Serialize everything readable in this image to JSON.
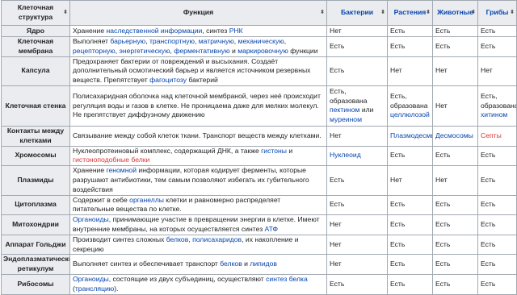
{
  "headers": {
    "structure": "Клеточная структура",
    "function": "Функция",
    "bacteria": "Бактерии",
    "plants": "Растения",
    "animals": "Животные",
    "fungi": "Грибы"
  },
  "rows": [
    {
      "name": "Ядро",
      "function": [
        {
          "t": "Хранение "
        },
        {
          "t": "наследственной информации",
          "l": true
        },
        {
          "t": ", синтез "
        },
        {
          "t": "РНК",
          "l": true
        }
      ],
      "bacteria": [
        {
          "t": "Нет"
        }
      ],
      "plants": [
        {
          "t": "Есть"
        }
      ],
      "animals": [
        {
          "t": "Есть"
        }
      ],
      "fungi": [
        {
          "t": "Есть"
        }
      ]
    },
    {
      "name": "Клеточная мембрана",
      "function": [
        {
          "t": "Выполняет "
        },
        {
          "t": "барьерную",
          "l": true
        },
        {
          "t": ", "
        },
        {
          "t": "транспортную",
          "l": true
        },
        {
          "t": ", "
        },
        {
          "t": "матричную",
          "l": true
        },
        {
          "t": ", "
        },
        {
          "t": "механическую",
          "l": true
        },
        {
          "t": ", "
        },
        {
          "t": "рецепторную",
          "l": true
        },
        {
          "t": ", "
        },
        {
          "t": "энергетическую",
          "l": true
        },
        {
          "t": ", "
        },
        {
          "t": "ферментативную",
          "l": true
        },
        {
          "t": " и "
        },
        {
          "t": "маркировочную",
          "l": true
        },
        {
          "t": " функции"
        }
      ],
      "bacteria": [
        {
          "t": "Есть"
        }
      ],
      "plants": [
        {
          "t": "Есть"
        }
      ],
      "animals": [
        {
          "t": "Есть"
        }
      ],
      "fungi": [
        {
          "t": "Есть"
        }
      ]
    },
    {
      "name": "Капсула",
      "function": [
        {
          "t": "Предохраняет бактерии от повреждений и высыхания. Создаёт дополнительный осмотический барьер и является источником резервных веществ. Препятствует "
        },
        {
          "t": "фагоцитозу",
          "l": true
        },
        {
          "t": " бактерий"
        }
      ],
      "bacteria": [
        {
          "t": "Есть"
        }
      ],
      "plants": [
        {
          "t": "Нет"
        }
      ],
      "animals": [
        {
          "t": "Нет"
        }
      ],
      "fungi": [
        {
          "t": "Нет"
        }
      ]
    },
    {
      "name": "Клеточная стенка",
      "function": [
        {
          "t": "Полисахаридная оболочка над клеточной мембраной, через неё происходит регуляция воды и газов в клетке. Не проницаема даже для мелких молекул. Не препятствует диффузному движению"
        }
      ],
      "bacteria": [
        {
          "t": "Есть, образована "
        },
        {
          "t": "пектином",
          "l": true
        },
        {
          "t": " или "
        },
        {
          "t": "муреином",
          "l": true
        }
      ],
      "plants": [
        {
          "t": "Есть, образована "
        },
        {
          "t": "целлюлозой",
          "l": true
        }
      ],
      "animals": [
        {
          "t": "Нет"
        }
      ],
      "fungi": [
        {
          "t": "Есть, образована "
        },
        {
          "t": "хитином",
          "l": true
        }
      ]
    },
    {
      "name": "Контакты между клетками",
      "function": [
        {
          "t": "Связывание между собой клеток ткани. Транспорт веществ между клетками."
        }
      ],
      "bacteria": [
        {
          "t": "Нет"
        }
      ],
      "plants": [
        {
          "t": "Плазмодесмы",
          "l": true
        }
      ],
      "animals": [
        {
          "t": "Десмосомы",
          "l": true
        }
      ],
      "fungi": [
        {
          "t": "Септы",
          "r": true
        }
      ]
    },
    {
      "name": "Хромосомы",
      "function": [
        {
          "t": "Нуклеопротеиновый комплекс, содержащий ДНК, а также "
        },
        {
          "t": "гистоны",
          "l": true
        },
        {
          "t": " и "
        },
        {
          "t": "гистоноподобные белки",
          "r": true
        }
      ],
      "bacteria": [
        {
          "t": "Нуклеоид",
          "l": true
        }
      ],
      "plants": [
        {
          "t": "Есть"
        }
      ],
      "animals": [
        {
          "t": "Есть"
        }
      ],
      "fungi": [
        {
          "t": "Есть"
        }
      ]
    },
    {
      "name": "Плазмиды",
      "function": [
        {
          "t": "Хранение "
        },
        {
          "t": "геномной",
          "l": true
        },
        {
          "t": " информации, которая кодирует ферменты, которые разрушают антибиотики, тем самым позволяют избегать их губительного воздействия"
        }
      ],
      "bacteria": [
        {
          "t": "Есть"
        }
      ],
      "plants": [
        {
          "t": "Нет"
        }
      ],
      "animals": [
        {
          "t": "Нет"
        }
      ],
      "fungi": [
        {
          "t": "Есть"
        }
      ]
    },
    {
      "name": "Цитоплазма",
      "function": [
        {
          "t": "Содержит в себе "
        },
        {
          "t": "органеллы",
          "l": true
        },
        {
          "t": " клетки и равномерно распределяет питательные вещества по клетке."
        }
      ],
      "bacteria": [
        {
          "t": "Есть"
        }
      ],
      "plants": [
        {
          "t": "Есть"
        }
      ],
      "animals": [
        {
          "t": "Есть"
        }
      ],
      "fungi": [
        {
          "t": "Есть"
        }
      ]
    },
    {
      "name": "Митохондрии",
      "function": [
        {
          "t": "Органоиды",
          "l": true
        },
        {
          "t": ", принимающие участие в превращении энергии в клетке. Имеют внутренние мембраны, на которых осуществляется синтез "
        },
        {
          "t": "АТФ",
          "l": true
        }
      ],
      "bacteria": [
        {
          "t": "Нет"
        }
      ],
      "plants": [
        {
          "t": "Есть"
        }
      ],
      "animals": [
        {
          "t": "Есть"
        }
      ],
      "fungi": [
        {
          "t": "Есть"
        }
      ]
    },
    {
      "name": "Аппарат Гольджи",
      "function": [
        {
          "t": "Производит синтез сложных "
        },
        {
          "t": "белков",
          "l": true
        },
        {
          "t": ", "
        },
        {
          "t": "полисахаридов",
          "l": true
        },
        {
          "t": ", их накопление и секрецию"
        }
      ],
      "bacteria": [
        {
          "t": "Нет"
        }
      ],
      "plants": [
        {
          "t": "Есть"
        }
      ],
      "animals": [
        {
          "t": "Есть"
        }
      ],
      "fungi": [
        {
          "t": "Есть"
        }
      ]
    },
    {
      "name": "Эндоплазматический ретикулум",
      "function": [
        {
          "t": "Выполняет синтез и обеспечивает транспорт "
        },
        {
          "t": "белков",
          "l": true
        },
        {
          "t": " и "
        },
        {
          "t": "липидов",
          "l": true
        }
      ],
      "bacteria": [
        {
          "t": "Нет"
        }
      ],
      "plants": [
        {
          "t": "Есть"
        }
      ],
      "animals": [
        {
          "t": "Есть"
        }
      ],
      "fungi": [
        {
          "t": "Есть"
        }
      ]
    },
    {
      "name": "Рибосомы",
      "function": [
        {
          "t": "Органоиды",
          "l": true
        },
        {
          "t": ", состоящие из двух субъединиц, осуществляют "
        },
        {
          "t": "синтез белка",
          "l": true
        },
        {
          "t": " ("
        },
        {
          "t": "трансляцию",
          "l": true
        },
        {
          "t": ")."
        }
      ],
      "bacteria": [
        {
          "t": "Есть"
        }
      ],
      "plants": [
        {
          "t": "Есть"
        }
      ],
      "animals": [
        {
          "t": "Есть"
        }
      ],
      "fungi": [
        {
          "t": "Есть"
        }
      ]
    }
  ]
}
